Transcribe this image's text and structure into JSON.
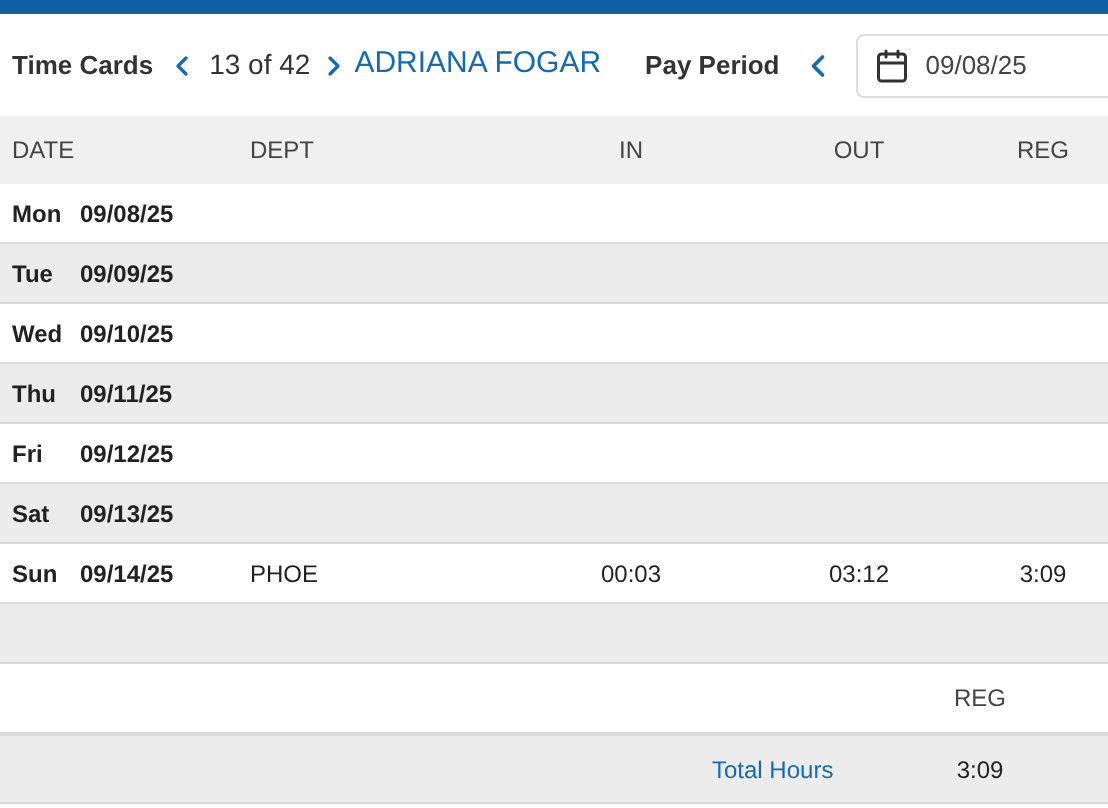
{
  "toolbar": {
    "title": "Time Cards",
    "counter": "13 of 42",
    "employee": "ADRIANA FOGAR",
    "pay_period_label": "Pay Period",
    "date_value": "09/08/25"
  },
  "table": {
    "columns": [
      "DATE",
      "DEPT",
      "IN",
      "OUT",
      "REG"
    ],
    "rows": [
      {
        "day": "Mon",
        "date": "09/08/25",
        "dept": "",
        "in": "",
        "out": "",
        "reg": ""
      },
      {
        "day": "Tue",
        "date": "09/09/25",
        "dept": "",
        "in": "",
        "out": "",
        "reg": ""
      },
      {
        "day": "Wed",
        "date": "09/10/25",
        "dept": "",
        "in": "",
        "out": "",
        "reg": ""
      },
      {
        "day": "Thu",
        "date": "09/11/25",
        "dept": "",
        "in": "",
        "out": "",
        "reg": ""
      },
      {
        "day": "Fri",
        "date": "09/12/25",
        "dept": "",
        "in": "",
        "out": "",
        "reg": ""
      },
      {
        "day": "Sat",
        "date": "09/13/25",
        "dept": "",
        "in": "",
        "out": "",
        "reg": ""
      },
      {
        "day": "Sun",
        "date": "09/14/25",
        "dept": "PHOE",
        "in": "00:03",
        "out": "03:12",
        "reg": "3:09"
      }
    ]
  },
  "summary": {
    "column": "REG",
    "label": "Total Hours",
    "value": "3:09"
  }
}
